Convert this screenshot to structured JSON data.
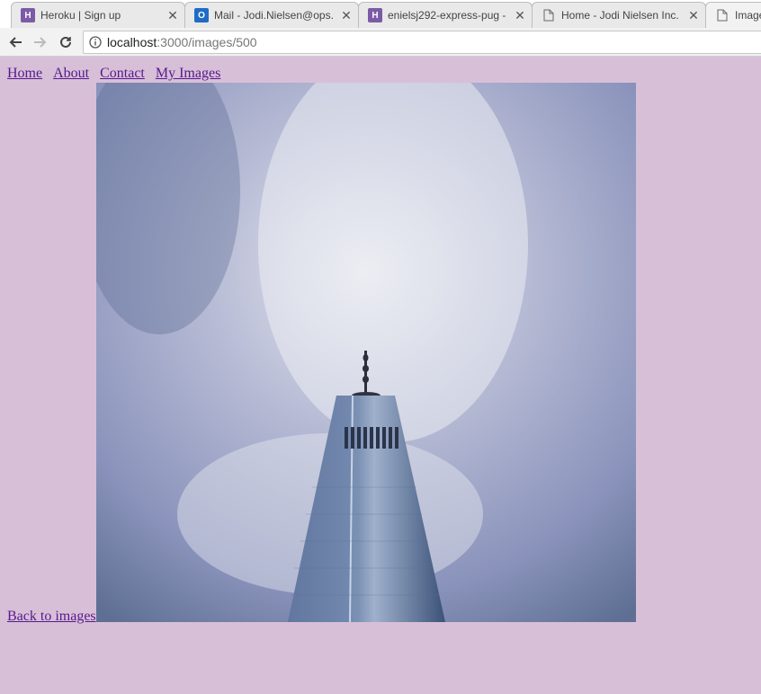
{
  "browser": {
    "tabs": [
      {
        "title": "Heroku | Sign up",
        "icon": "heroku-icon"
      },
      {
        "title": "Mail - Jodi.Nielsen@ops.",
        "icon": "outlook-icon"
      },
      {
        "title": "enielsj292-express-pug -",
        "icon": "heroku-icon"
      },
      {
        "title": "Home - Jodi Nielsen Inc.",
        "icon": "page-icon"
      },
      {
        "title": "Image",
        "icon": "page-icon"
      }
    ],
    "url_host": "localhost",
    "url_path": ":3000/images/500"
  },
  "nav": {
    "home": "Home",
    "about": "About",
    "contact": "Contact",
    "my_images": "My Images"
  },
  "back_link": "Back to images",
  "colors": {
    "page_bg": "#d8bfd8",
    "link": "#551a8b"
  }
}
